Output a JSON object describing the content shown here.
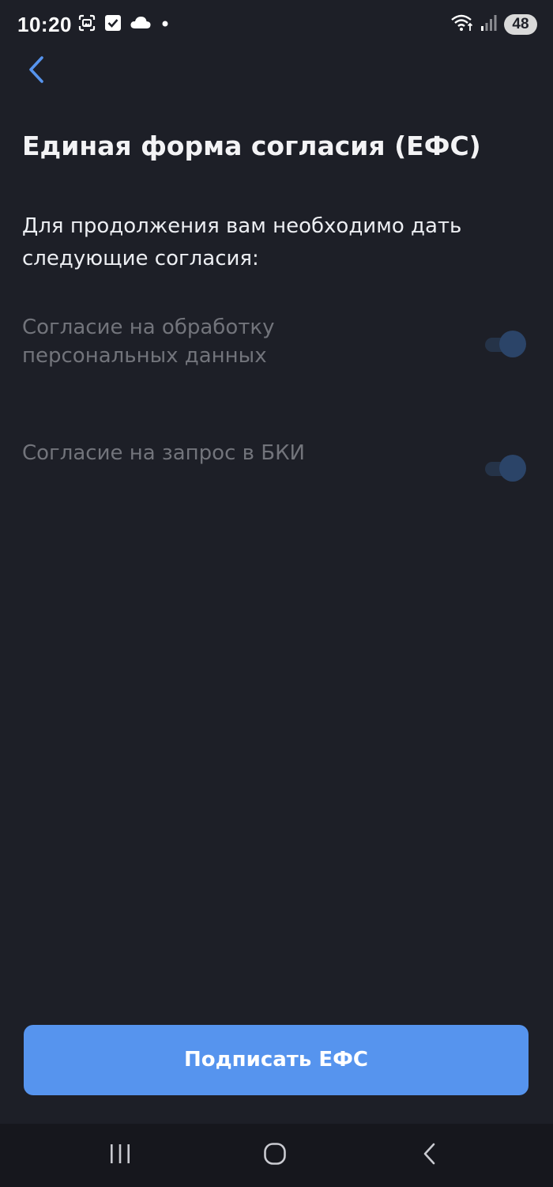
{
  "status_bar": {
    "time": "10:20",
    "battery": "48",
    "left_icons": [
      "screenshot-icon",
      "checkbox-icon",
      "cloud-icon",
      "dot-icon"
    ],
    "right_icons": [
      "wifi-icon",
      "signal-icon",
      "battery-icon"
    ]
  },
  "header": {
    "back_icon": "chevron-left-icon"
  },
  "main": {
    "title": "Единая форма согласия (ЕФС)",
    "intro": "Для продолжения вам необходимо дать следующие согласия:",
    "consents": [
      {
        "label": "Согласие на обработку персональных данных",
        "enabled": true
      },
      {
        "label": "Согласие на запрос в БКИ",
        "enabled": true
      }
    ]
  },
  "actions": {
    "sign_label": "Подписать ЕФС"
  },
  "nav_bar": {
    "icons": [
      "recents-icon",
      "home-icon",
      "back-icon"
    ]
  },
  "colors": {
    "background": "#1d1f27",
    "accent": "#5694ee",
    "muted_text": "#72747b",
    "toggle_track": "#253348",
    "toggle_knob": "#2b4468",
    "nav_background": "#16171d"
  }
}
